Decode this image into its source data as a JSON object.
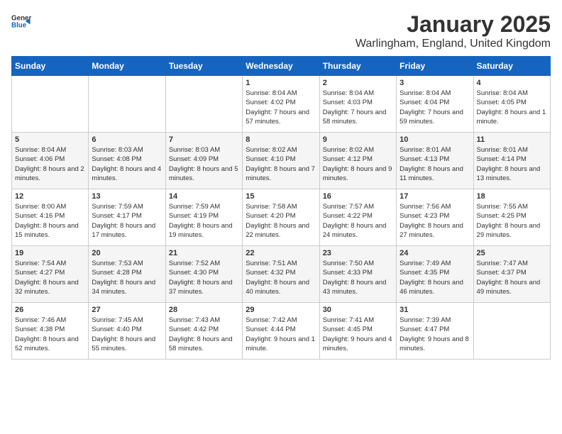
{
  "logo": {
    "general": "General",
    "blue": "Blue"
  },
  "title": "January 2025",
  "subtitle": "Warlingham, England, United Kingdom",
  "days_of_week": [
    "Sunday",
    "Monday",
    "Tuesday",
    "Wednesday",
    "Thursday",
    "Friday",
    "Saturday"
  ],
  "weeks": [
    [
      {
        "day": "",
        "info": ""
      },
      {
        "day": "",
        "info": ""
      },
      {
        "day": "",
        "info": ""
      },
      {
        "day": "1",
        "info": "Sunrise: 8:04 AM\nSunset: 4:02 PM\nDaylight: 7 hours and 57 minutes."
      },
      {
        "day": "2",
        "info": "Sunrise: 8:04 AM\nSunset: 4:03 PM\nDaylight: 7 hours and 58 minutes."
      },
      {
        "day": "3",
        "info": "Sunrise: 8:04 AM\nSunset: 4:04 PM\nDaylight: 7 hours and 59 minutes."
      },
      {
        "day": "4",
        "info": "Sunrise: 8:04 AM\nSunset: 4:05 PM\nDaylight: 8 hours and 1 minute."
      }
    ],
    [
      {
        "day": "5",
        "info": "Sunrise: 8:04 AM\nSunset: 4:06 PM\nDaylight: 8 hours and 2 minutes."
      },
      {
        "day": "6",
        "info": "Sunrise: 8:03 AM\nSunset: 4:08 PM\nDaylight: 8 hours and 4 minutes."
      },
      {
        "day": "7",
        "info": "Sunrise: 8:03 AM\nSunset: 4:09 PM\nDaylight: 8 hours and 5 minutes."
      },
      {
        "day": "8",
        "info": "Sunrise: 8:02 AM\nSunset: 4:10 PM\nDaylight: 8 hours and 7 minutes."
      },
      {
        "day": "9",
        "info": "Sunrise: 8:02 AM\nSunset: 4:12 PM\nDaylight: 8 hours and 9 minutes."
      },
      {
        "day": "10",
        "info": "Sunrise: 8:01 AM\nSunset: 4:13 PM\nDaylight: 8 hours and 11 minutes."
      },
      {
        "day": "11",
        "info": "Sunrise: 8:01 AM\nSunset: 4:14 PM\nDaylight: 8 hours and 13 minutes."
      }
    ],
    [
      {
        "day": "12",
        "info": "Sunrise: 8:00 AM\nSunset: 4:16 PM\nDaylight: 8 hours and 15 minutes."
      },
      {
        "day": "13",
        "info": "Sunrise: 7:59 AM\nSunset: 4:17 PM\nDaylight: 8 hours and 17 minutes."
      },
      {
        "day": "14",
        "info": "Sunrise: 7:59 AM\nSunset: 4:19 PM\nDaylight: 8 hours and 19 minutes."
      },
      {
        "day": "15",
        "info": "Sunrise: 7:58 AM\nSunset: 4:20 PM\nDaylight: 8 hours and 22 minutes."
      },
      {
        "day": "16",
        "info": "Sunrise: 7:57 AM\nSunset: 4:22 PM\nDaylight: 8 hours and 24 minutes."
      },
      {
        "day": "17",
        "info": "Sunrise: 7:56 AM\nSunset: 4:23 PM\nDaylight: 8 hours and 27 minutes."
      },
      {
        "day": "18",
        "info": "Sunrise: 7:55 AM\nSunset: 4:25 PM\nDaylight: 8 hours and 29 minutes."
      }
    ],
    [
      {
        "day": "19",
        "info": "Sunrise: 7:54 AM\nSunset: 4:27 PM\nDaylight: 8 hours and 32 minutes."
      },
      {
        "day": "20",
        "info": "Sunrise: 7:53 AM\nSunset: 4:28 PM\nDaylight: 8 hours and 34 minutes."
      },
      {
        "day": "21",
        "info": "Sunrise: 7:52 AM\nSunset: 4:30 PM\nDaylight: 8 hours and 37 minutes."
      },
      {
        "day": "22",
        "info": "Sunrise: 7:51 AM\nSunset: 4:32 PM\nDaylight: 8 hours and 40 minutes."
      },
      {
        "day": "23",
        "info": "Sunrise: 7:50 AM\nSunset: 4:33 PM\nDaylight: 8 hours and 43 minutes."
      },
      {
        "day": "24",
        "info": "Sunrise: 7:49 AM\nSunset: 4:35 PM\nDaylight: 8 hours and 46 minutes."
      },
      {
        "day": "25",
        "info": "Sunrise: 7:47 AM\nSunset: 4:37 PM\nDaylight: 8 hours and 49 minutes."
      }
    ],
    [
      {
        "day": "26",
        "info": "Sunrise: 7:46 AM\nSunset: 4:38 PM\nDaylight: 8 hours and 52 minutes."
      },
      {
        "day": "27",
        "info": "Sunrise: 7:45 AM\nSunset: 4:40 PM\nDaylight: 8 hours and 55 minutes."
      },
      {
        "day": "28",
        "info": "Sunrise: 7:43 AM\nSunset: 4:42 PM\nDaylight: 8 hours and 58 minutes."
      },
      {
        "day": "29",
        "info": "Sunrise: 7:42 AM\nSunset: 4:44 PM\nDaylight: 9 hours and 1 minute."
      },
      {
        "day": "30",
        "info": "Sunrise: 7:41 AM\nSunset: 4:45 PM\nDaylight: 9 hours and 4 minutes."
      },
      {
        "day": "31",
        "info": "Sunrise: 7:39 AM\nSunset: 4:47 PM\nDaylight: 9 hours and 8 minutes."
      },
      {
        "day": "",
        "info": ""
      }
    ]
  ]
}
